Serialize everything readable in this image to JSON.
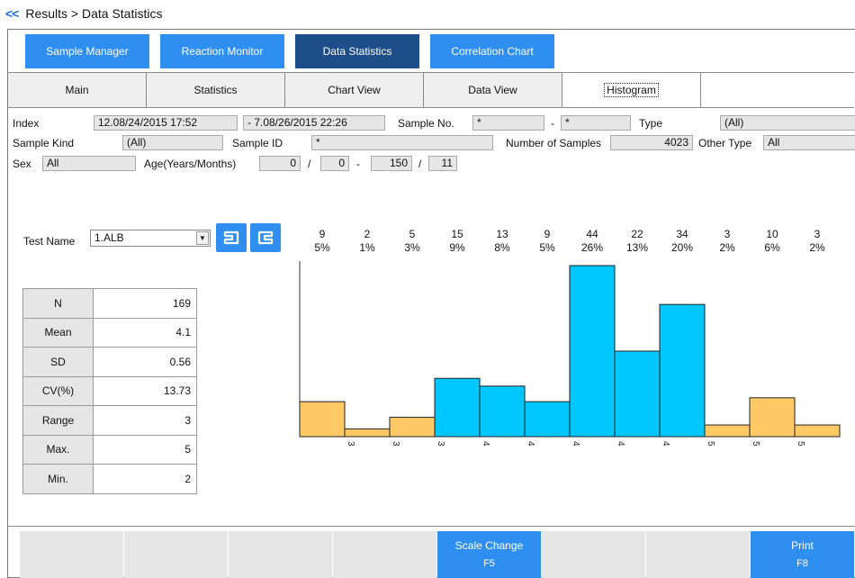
{
  "breadcrumb": {
    "back": "<<",
    "text": "Results > Data Statistics"
  },
  "top_tabs": [
    {
      "label": "Sample Manager",
      "active": false
    },
    {
      "label": "Reaction Monitor",
      "active": false
    },
    {
      "label": "Data Statistics",
      "active": true
    },
    {
      "label": "Correlation Chart",
      "active": false
    }
  ],
  "sub_tabs": [
    {
      "label": "Main",
      "active": false
    },
    {
      "label": "Statistics",
      "active": false
    },
    {
      "label": "Chart View",
      "active": false
    },
    {
      "label": "Data View",
      "active": false
    },
    {
      "label": "Histogram",
      "active": true
    }
  ],
  "filters": {
    "index_label": "Index",
    "index_from": "12.08/24/2015 17:52",
    "index_to": "- 7.08/26/2015 22:26",
    "sample_no_label": "Sample No.",
    "sample_no_from": "*",
    "sample_no_dash": "-",
    "sample_no_to": "*",
    "type_label": "Type",
    "type_value": "(All)",
    "sample_kind_label": "Sample Kind",
    "sample_kind_value": "(All)",
    "sample_id_label": "Sample ID",
    "sample_id_value": "*",
    "num_samples_label": "Number of Samples",
    "num_samples_value": "4023",
    "other_type_label": "Other Type",
    "other_type_value": "All",
    "sex_label": "Sex",
    "sex_value": "All",
    "age_label": "Age(Years/Months)",
    "age_from_years": "0",
    "age_slash": "/",
    "age_from_months": "0",
    "age_dash": "-",
    "age_to_years": "150",
    "age_to_months": "11"
  },
  "test_name": {
    "label": "Test Name",
    "value": "1.ALB"
  },
  "icons": [
    "left-pointer-icon",
    "right-pointer-icon"
  ],
  "stats": [
    {
      "key": "N",
      "value": "169"
    },
    {
      "key": "Mean",
      "value": "4.1"
    },
    {
      "key": "SD",
      "value": "0.56"
    },
    {
      "key": "CV(%)",
      "value": "13.73"
    },
    {
      "key": "Range",
      "value": "3"
    },
    {
      "key": "Max.",
      "value": "5"
    },
    {
      "key": "Min.",
      "value": "2"
    }
  ],
  "chart_data": {
    "type": "bar",
    "counts": [
      9,
      2,
      5,
      15,
      13,
      9,
      44,
      22,
      34,
      3,
      10,
      3
    ],
    "percents": [
      "5%",
      "1%",
      "3%",
      "9%",
      "8%",
      "5%",
      "26%",
      "13%",
      "20%",
      "2%",
      "6%",
      "2%"
    ],
    "tick_labels": [
      "3",
      "3",
      "3",
      "4",
      "4",
      "4",
      "4",
      "4",
      "5",
      "5",
      "5"
    ],
    "bar_colors": [
      "#ffc965",
      "#ffc965",
      "#ffc965",
      "#00c8ff",
      "#00c8ff",
      "#00c8ff",
      "#00c8ff",
      "#00c8ff",
      "#00c8ff",
      "#ffc965",
      "#ffc965",
      "#ffc965"
    ],
    "colors": {
      "in_range": "#00c8ff",
      "out_of_range": "#ffc965"
    }
  },
  "function_keys": [
    {
      "label": "",
      "key": "",
      "enabled": false
    },
    {
      "label": "",
      "key": "",
      "enabled": false
    },
    {
      "label": "",
      "key": "",
      "enabled": false
    },
    {
      "label": "",
      "key": "",
      "enabled": false
    },
    {
      "label": "Scale Change",
      "key": "F5",
      "enabled": true
    },
    {
      "label": "",
      "key": "",
      "enabled": false
    },
    {
      "label": "",
      "key": "",
      "enabled": false
    },
    {
      "label": "Print",
      "key": "F8",
      "enabled": true
    }
  ]
}
